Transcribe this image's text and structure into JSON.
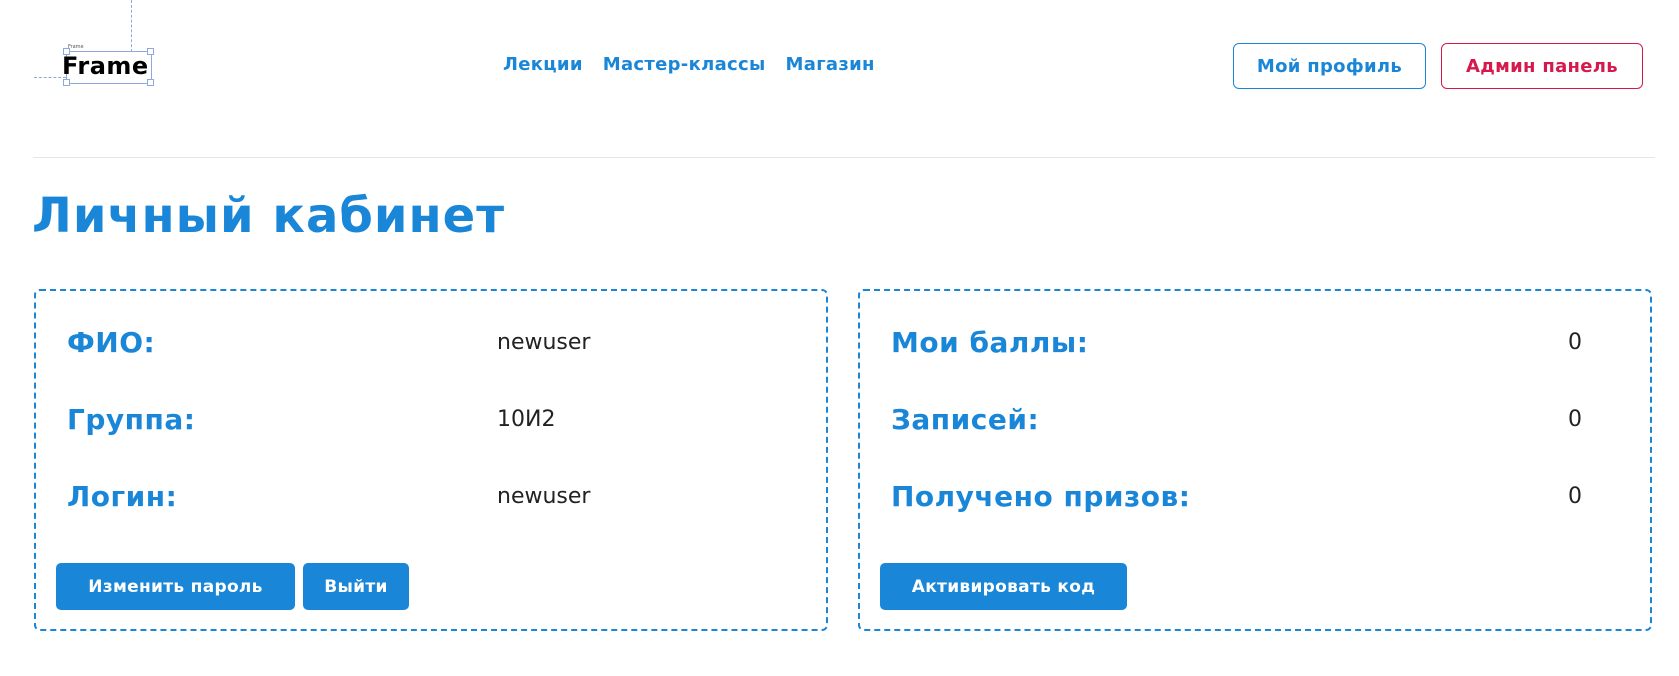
{
  "header": {
    "logo_text": "Frame",
    "logo_tiny_label": "Frame",
    "nav": [
      "Лекции",
      "Мастер-классы",
      "Магазин"
    ],
    "profile_button": "Мой профиль",
    "admin_button": "Админ панель"
  },
  "page": {
    "title": "Личный кабинет"
  },
  "user_card": {
    "rows": [
      {
        "label": "ФИО:",
        "value": "newuser"
      },
      {
        "label": "Группа:",
        "value": "10И2"
      },
      {
        "label": "Логин:",
        "value": "newuser"
      }
    ],
    "change_password_button": "Изменить пароль",
    "logout_button": "Выйти"
  },
  "stats_card": {
    "rows": [
      {
        "label": "Мои баллы:",
        "value": "0"
      },
      {
        "label": "Записей:",
        "value": "0"
      },
      {
        "label": "Получено призов:",
        "value": "0"
      }
    ],
    "activate_code_button": "Активировать код"
  },
  "colors": {
    "accent": "#1a86d8",
    "admin": "#d6194c",
    "divider": "#e3e6ea"
  }
}
